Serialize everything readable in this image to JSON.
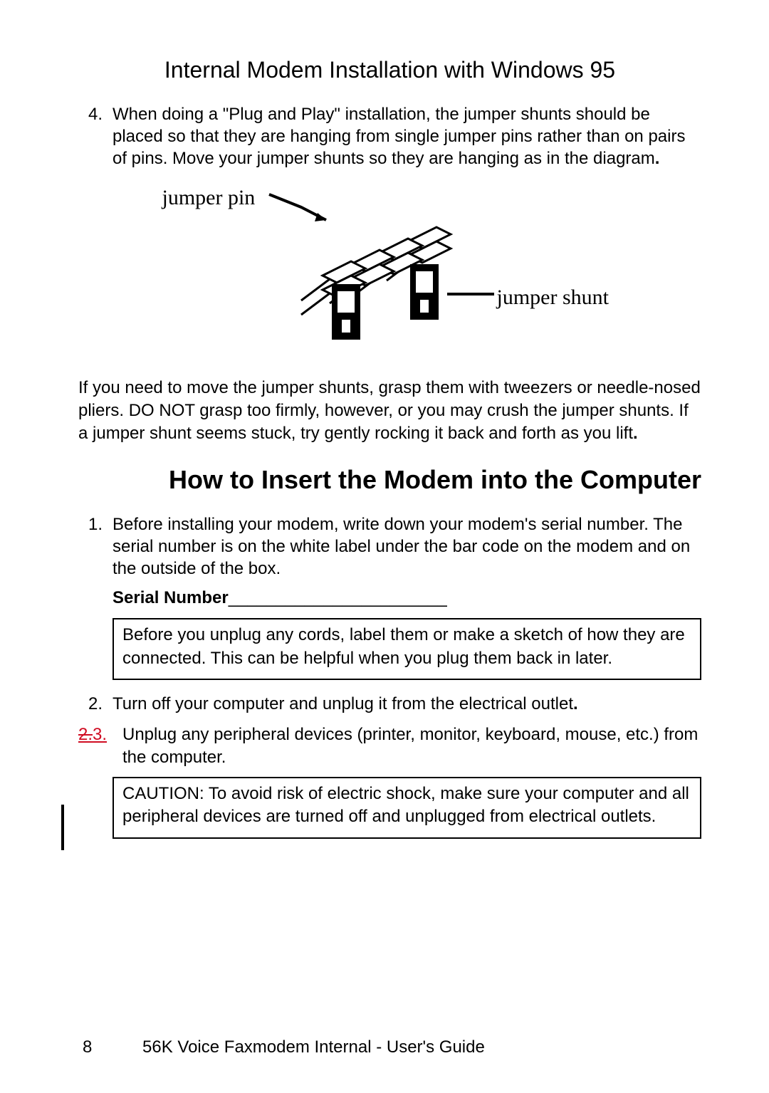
{
  "section_title": "Internal Modem Installation with Windows 95",
  "step4_num": "4.",
  "step4_text": "When doing a \"Plug and Play\" installation, the jumper shunts should be placed so that they are hanging from single jumper pins rather than on pairs of pins. Move your jumper shunts so they are hanging as in the diagram",
  "step4_end": ".",
  "diagram": {
    "label_pin": "jumper pin",
    "label_shunt": "jumper shunt"
  },
  "tweezer_note": "If you need to move the jumper shunts, grasp them with tweezers or needle-nosed pliers. DO NOT grasp too firmly, however, or you may crush the jumper shunts. If a jumper shunt seems stuck, try gently rocking it back and forth as you lift",
  "tweezer_end": ".",
  "heading": "How to Insert the Modem into the Computer",
  "step1_num": "1.",
  "step1_text": "Before installing your modem, write down your modem's serial number. The serial number is on the white label under the bar code on the modem and on the outside of the box.",
  "serial_label": "Serial Number",
  "serial_line": "_______________________",
  "box_unplug": "Before you unplug any cords, label them or make a sketch of how they are connected. This can be helpful when you plug them back in later.",
  "step2_num": "2.",
  "step2_text": "Turn off your computer and unplug it from the electrical outlet",
  "step2_end": ".",
  "step3_struck": "2.",
  "step3_new": "3.",
  "step3_text": "Unplug any peripheral devices (printer, monitor, keyboard, mouse, etc.) from the computer.",
  "box_caution": "CAUTION: To avoid risk of electric shock, make sure your computer and all peripheral devices are turned off and unplugged from electrical outlets.",
  "footer": {
    "page": "8",
    "title": "56K Voice Faxmodem Internal - User's Guide"
  }
}
